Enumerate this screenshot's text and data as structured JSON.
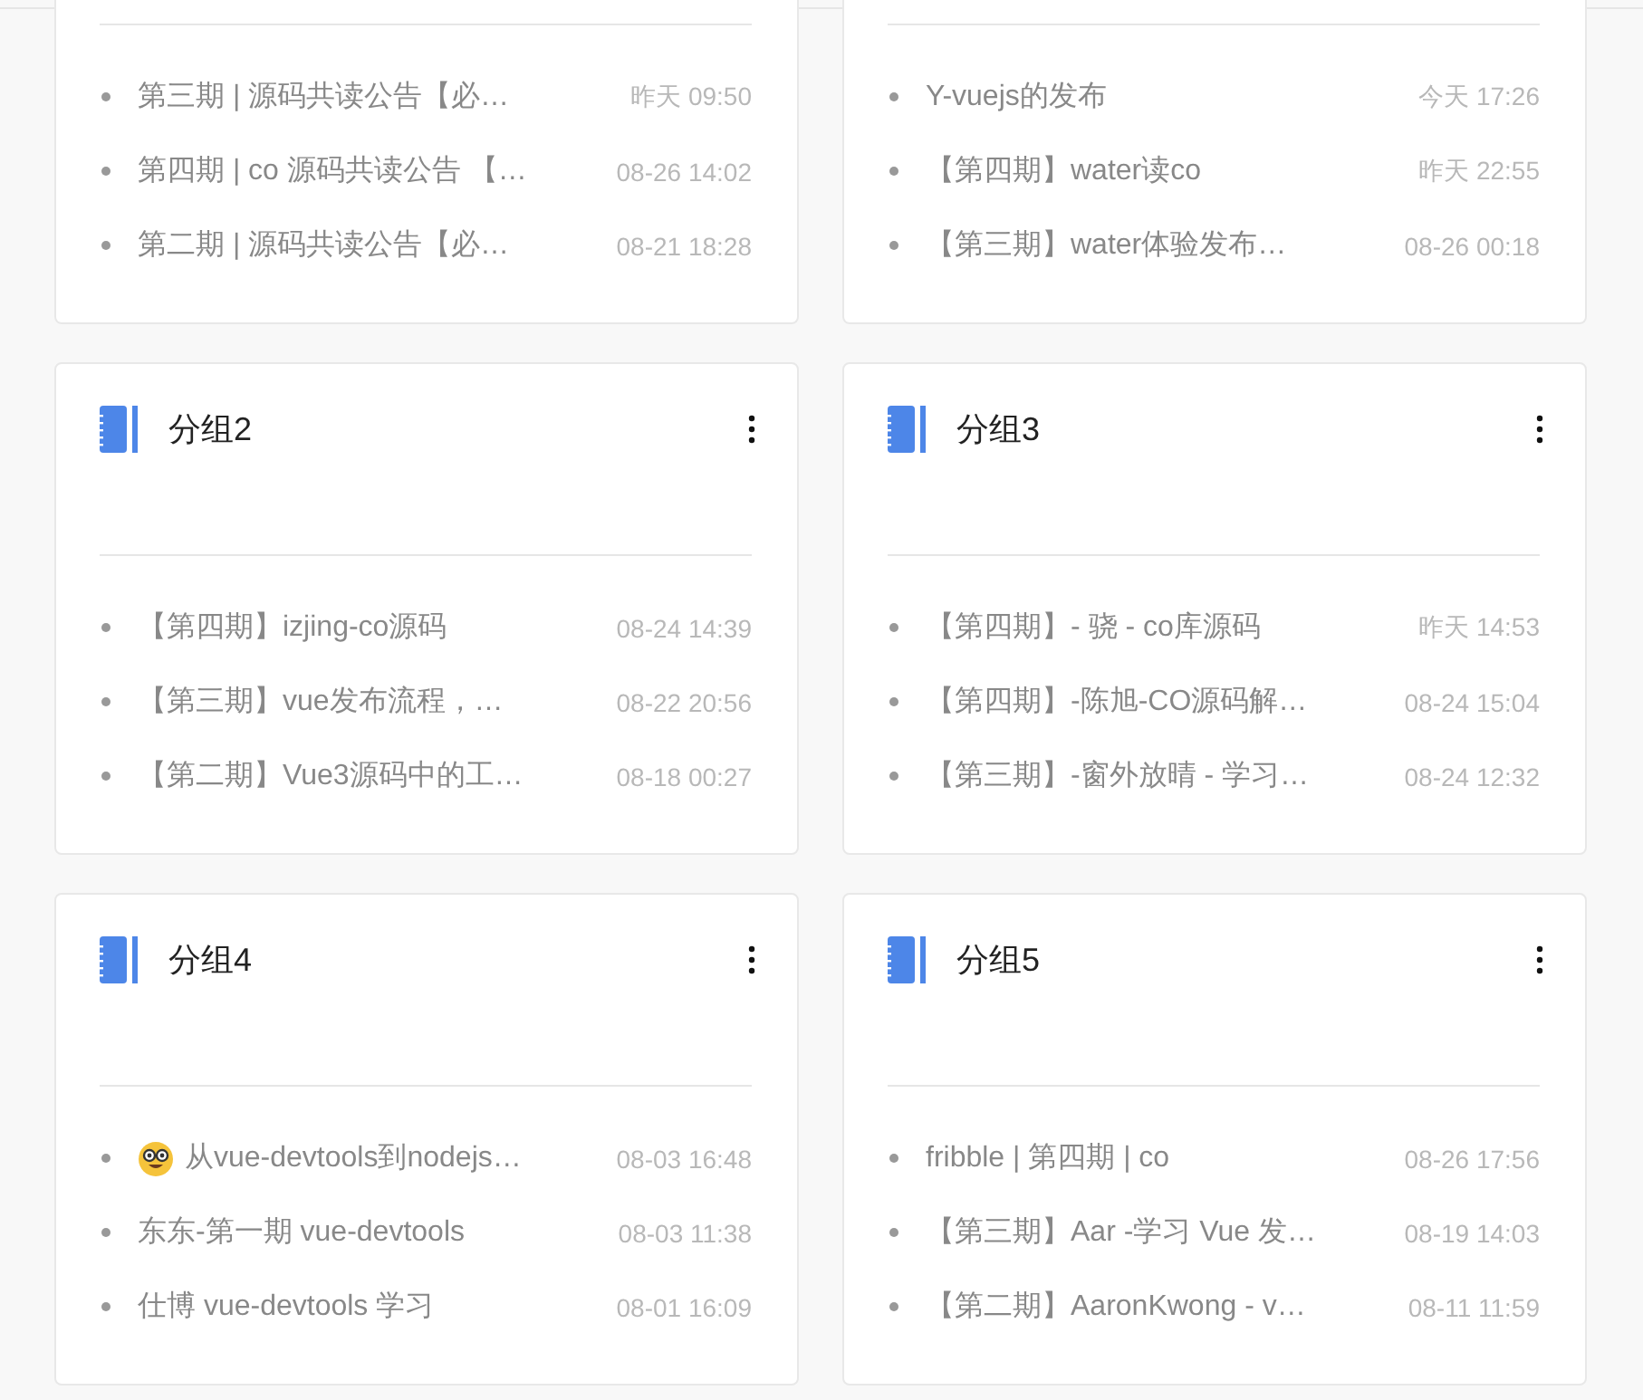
{
  "groups": [
    {
      "items": [
        {
          "kind": "plain",
          "title": "第三期 | 源码共读公告【必…",
          "time": "昨天 09:50"
        },
        {
          "kind": "plain",
          "title": "第四期 | co 源码共读公告 【…",
          "time": "08-26 14:02"
        },
        {
          "kind": "plain",
          "title": "第二期 | 源码共读公告【必…",
          "time": "08-21 18:28"
        }
      ]
    },
    {
      "items": [
        {
          "kind": "plain",
          "title": "Y-vuejs的发布",
          "time": "今天 17:26"
        },
        {
          "kind": "plain",
          "title": "【第四期】water读co",
          "time": "昨天 22:55"
        },
        {
          "kind": "plain",
          "title": "【第三期】water体验发布…",
          "time": "08-26 00:18"
        }
      ]
    },
    {
      "title": "分组2",
      "items": [
        {
          "kind": "plain",
          "title": "【第四期】izjing-co源码",
          "time": "08-24 14:39"
        },
        {
          "kind": "plain",
          "title": "【第三期】vue发布流程，…",
          "time": "08-22 20:56"
        },
        {
          "kind": "plain",
          "title": "【第二期】Vue3源码中的工…",
          "time": "08-18 00:27"
        }
      ]
    },
    {
      "title": "分组3",
      "items": [
        {
          "kind": "plain",
          "title": "【第四期】- 骁 - co库源码",
          "time": "昨天 14:53"
        },
        {
          "kind": "plain",
          "title": "【第四期】-陈旭-CO源码解…",
          "time": "08-24 15:04"
        },
        {
          "kind": "plain",
          "title": "【第三期】-窗外放晴 - 学习…",
          "time": "08-24 12:32"
        }
      ]
    },
    {
      "title": "分组4",
      "items": [
        {
          "kind": "emoji",
          "title": "从vue-devtools到nodejs…",
          "time": "08-03 16:48"
        },
        {
          "kind": "plain",
          "title": "东东-第一期 vue-devtools",
          "time": "08-03 11:38"
        },
        {
          "kind": "plain",
          "title": "仕博 vue-devtools 学习",
          "time": "08-01 16:09"
        }
      ]
    },
    {
      "title": "分组5",
      "items": [
        {
          "kind": "plain",
          "title": "fribble | 第四期 | co",
          "time": "08-26 17:56"
        },
        {
          "kind": "plain",
          "title": "【第三期】Aar -学习 Vue 发…",
          "time": "08-19 14:03"
        },
        {
          "kind": "plain",
          "title": "【第二期】AaronKwong - v…",
          "time": "08-11 11:59"
        }
      ]
    }
  ]
}
